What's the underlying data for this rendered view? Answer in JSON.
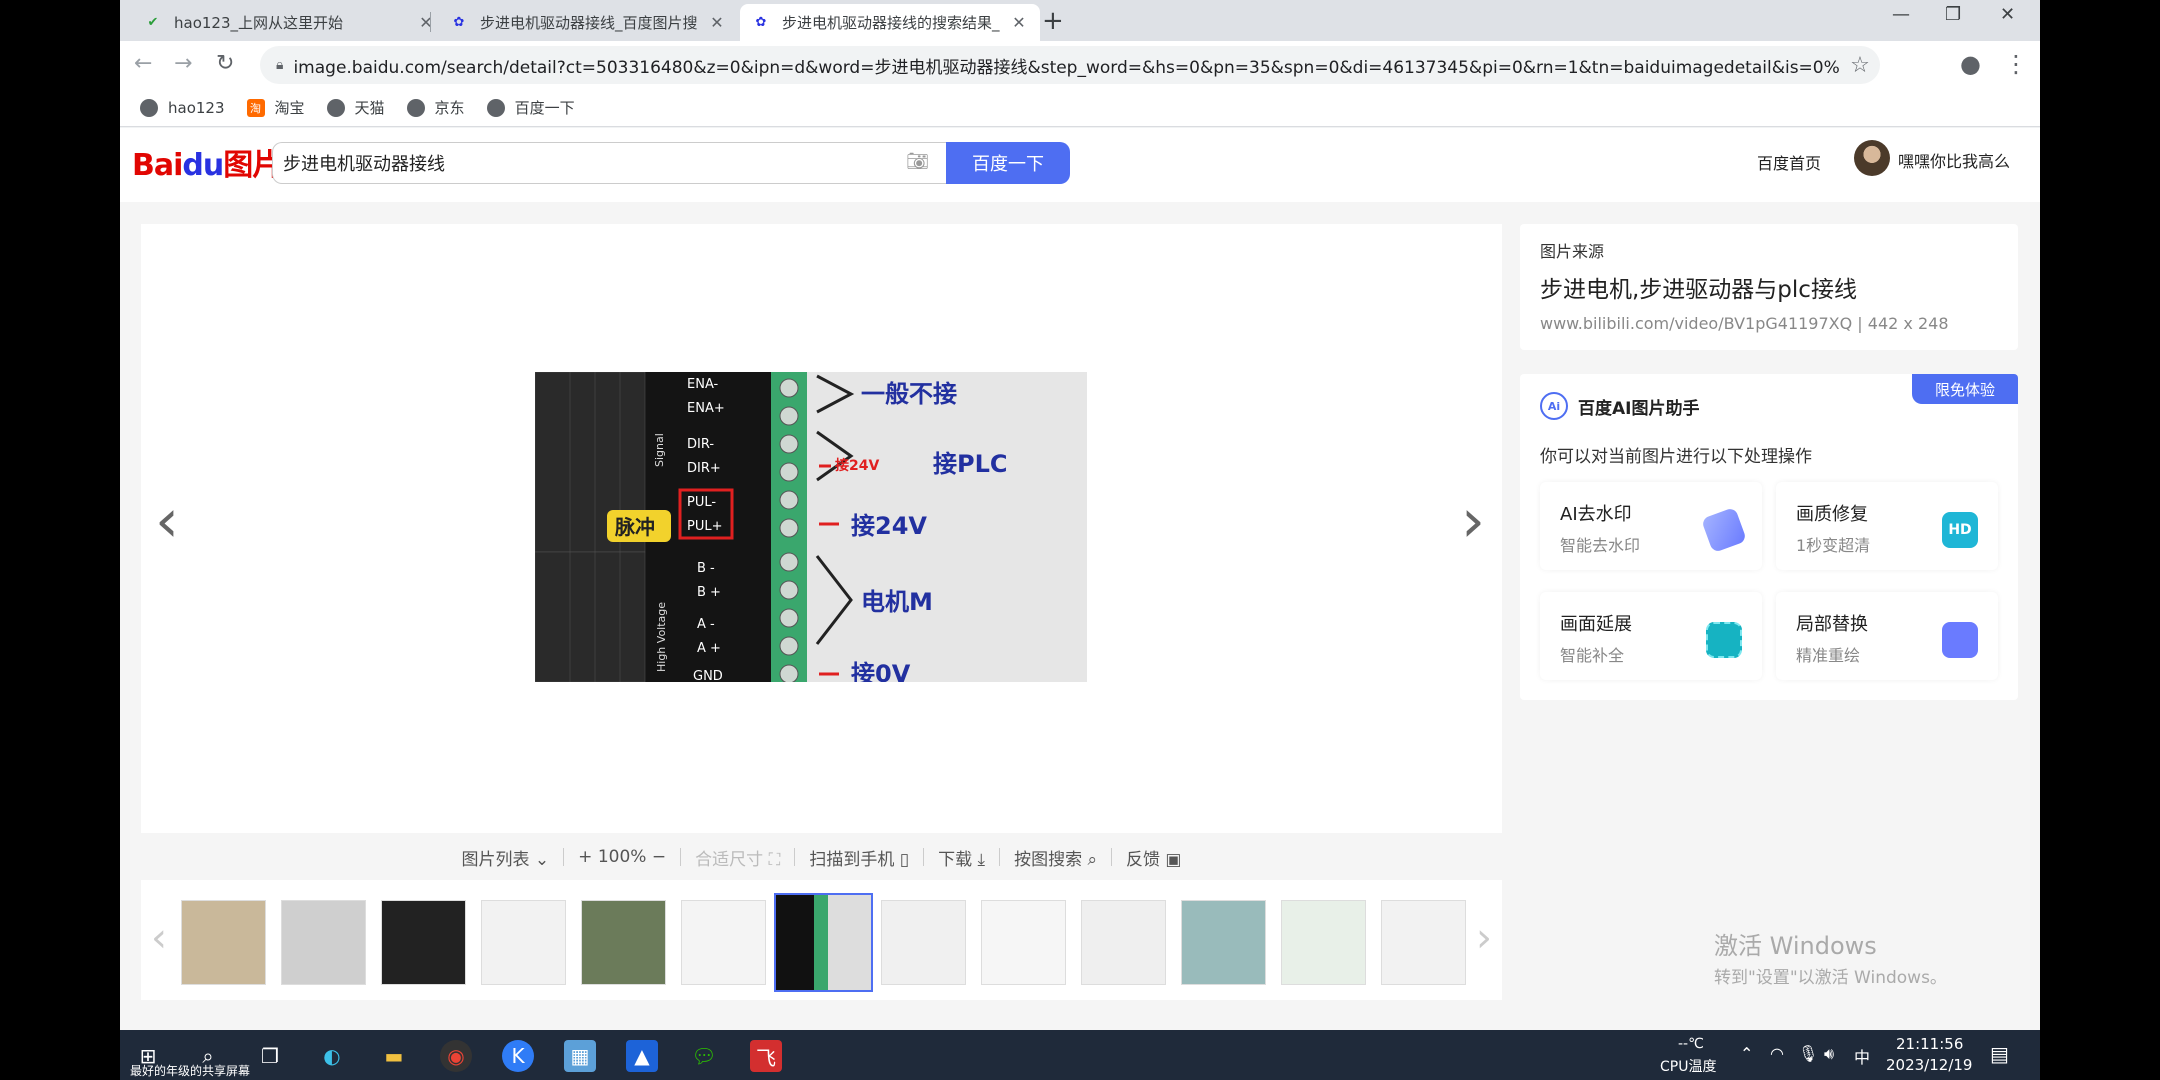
{
  "tabs": [
    {
      "title": "hao123_上网从这里开始",
      "close": "✕"
    },
    {
      "title": "步进电机驱动器接线_百度图片搜",
      "close": "✕"
    },
    {
      "title": "步进电机驱动器接线的搜索结果_",
      "close": "✕"
    }
  ],
  "new_tab": "+",
  "window_controls": {
    "minimize": "—",
    "maximize": "❐",
    "close": "✕"
  },
  "nav": {
    "back": "←",
    "forward": "→",
    "reload": "↻"
  },
  "address": {
    "url": "image.baidu.com/search/detail?ct=503316480&z=0&ipn=d&word=步进电机驱动器接线&step_word=&hs=0&pn=35&spn=0&di=46137345&pi=0&rn=1&tn=baiduimagedetail&is=0%2C0...",
    "star": "☆"
  },
  "bookmarks": [
    {
      "label": "hao123"
    },
    {
      "label": "淘宝"
    },
    {
      "label": "天猫"
    },
    {
      "label": "京东"
    },
    {
      "label": "百度一下"
    }
  ],
  "header": {
    "logo_text": "Bai",
    "logo_paw": "du",
    "logo_suffix": "图片",
    "search_value": "步进电机驱动器接线",
    "search_button": "百度一下",
    "home_link": "百度首页",
    "username": "嘿嘿你比我高么"
  },
  "viewer": {
    "prev": "‹",
    "next": "›",
    "image_labels": {
      "signal": "Signal",
      "high_voltage": "High Voltage",
      "pulse_badge": "脉冲",
      "ena_minus": "ENA-",
      "ena_plus": "ENA+",
      "dir_minus": "DIR-",
      "dir_plus": "DIR+",
      "pul_minus": "PUL-",
      "pul_plus": "PUL+",
      "b_minus": "B -",
      "b_plus": "B +",
      "a_minus": "A -",
      "a_plus": "A +",
      "gnd": "GND",
      "note1": "一般不接",
      "note2_small": "接24V",
      "note2": "接PLC",
      "note3": "接24V",
      "note4": "电机M",
      "note5": "接0V"
    }
  },
  "image_toolbar": [
    {
      "label": "图片列表 ⌄",
      "dim": false
    },
    {
      "label": "+  100%  −",
      "dim": false
    },
    {
      "label": "合适尺寸 ⛶",
      "dim": true
    },
    {
      "label": "扫描到手机 ▯",
      "dim": false
    },
    {
      "label": "下载 ⤓",
      "dim": false
    },
    {
      "label": "按图搜索 ⌕",
      "dim": false
    },
    {
      "label": "反馈 ▣",
      "dim": false
    }
  ],
  "thumbnails_count": 13,
  "selected_thumbnail": 6,
  "source": {
    "label": "图片来源",
    "title": "步进电机,步进驱动器与plc接线",
    "url": "www.bilibili.com/video/BV1pG41197XQ | 442 x 248"
  },
  "ai": {
    "badge": "限免体验",
    "icon": "Ai",
    "title": "百度AI图片助手",
    "desc": "你可以对当前图片进行以下处理操作",
    "tools": [
      {
        "title": "AI去水印",
        "sub": "智能去水印",
        "color": "#7b8cff",
        "glyph": ""
      },
      {
        "title": "画质修复",
        "sub": "1秒变超清",
        "color": "#1fb6d6",
        "glyph": "HD"
      },
      {
        "title": "画面延展",
        "sub": "智能补全",
        "color": "#16b3c2",
        "glyph": ""
      },
      {
        "title": "局部替换",
        "sub": "精准重绘",
        "color": "#6a7bff",
        "glyph": ""
      }
    ]
  },
  "watermark": {
    "line1": "激活 Windows",
    "line2": "转到\"设置\"以激活 Windows。"
  },
  "taskbar": {
    "start_tooltip": "最好的年级的共享屏幕",
    "temp": "--℃",
    "temp_label": "CPU温度",
    "ime": "中",
    "time": "21:11:56",
    "date": "2023/12/19"
  }
}
